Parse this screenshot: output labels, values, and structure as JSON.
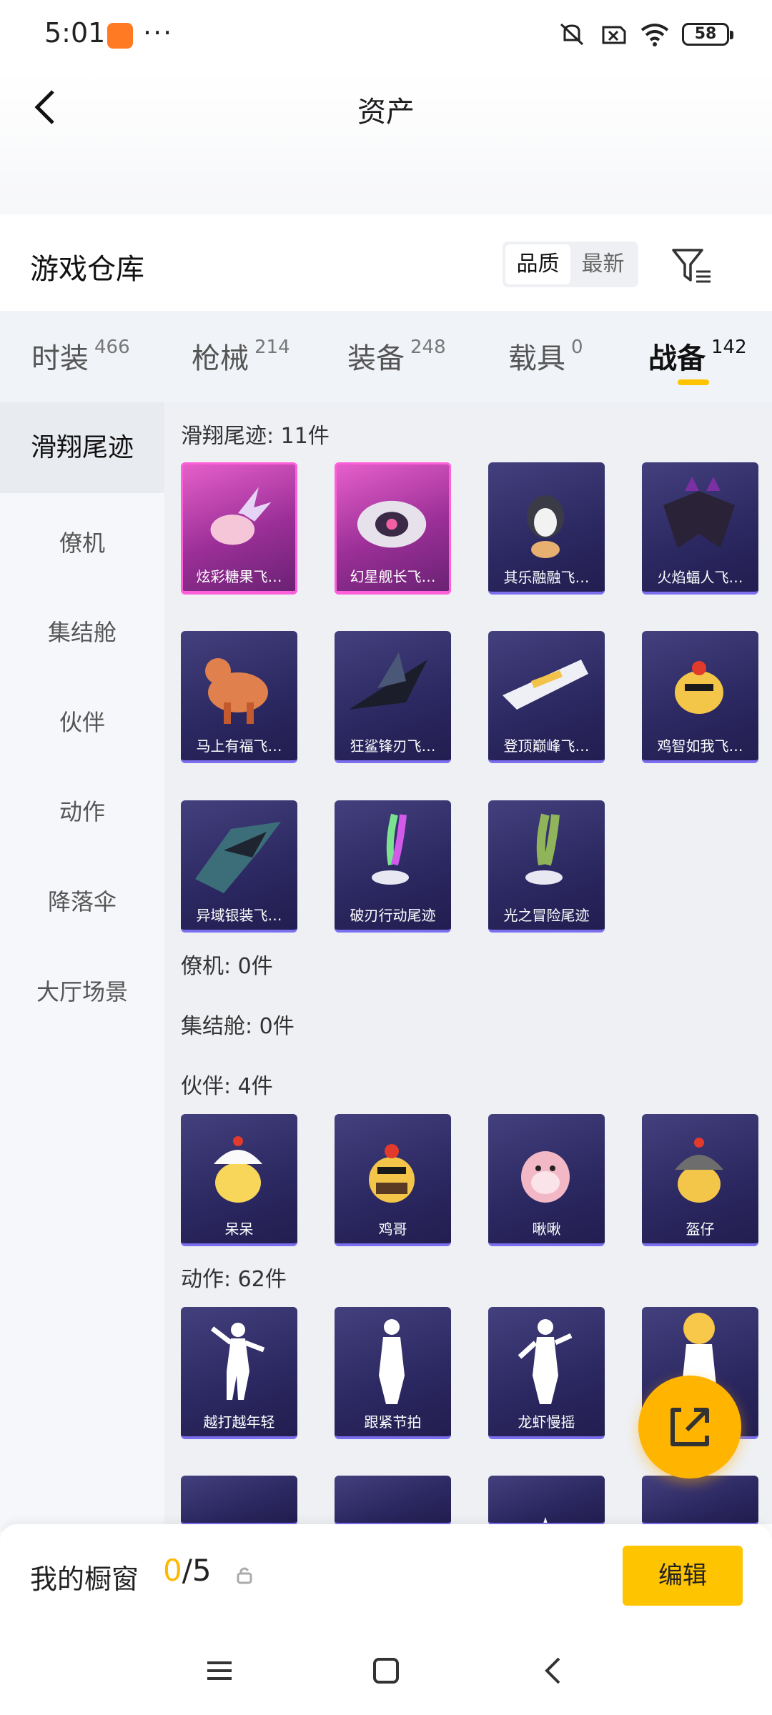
{
  "status_bar": {
    "time": "5:01",
    "dots": "···",
    "battery": "58"
  },
  "header": {
    "title": "资产"
  },
  "warehouse": {
    "title": "游戏仓库",
    "sort_options": [
      "品质",
      "最新"
    ]
  },
  "category_tabs": [
    {
      "label": "时装",
      "count": "466"
    },
    {
      "label": "枪械",
      "count": "214"
    },
    {
      "label": "装备",
      "count": "248"
    },
    {
      "label": "载具",
      "count": "0"
    },
    {
      "label": "战备",
      "count": "142"
    }
  ],
  "sidebar": [
    "滑翔尾迹",
    "僚机",
    "集结舱",
    "伙伴",
    "动作",
    "降落伞",
    "大厅场景"
  ],
  "sections": {
    "glide": {
      "title": "滑翔尾迹: 11件",
      "items": [
        "炫彩糖果飞…",
        "幻星舰长飞…",
        "其乐融融飞…",
        "火焰蝠人飞…",
        "马上有福飞…",
        "狂鲨锋刃飞…",
        "登顶巅峰飞…",
        "鸡智如我飞…",
        "异域银装飞…",
        "破刃行动尾迹",
        "光之冒险尾迹"
      ]
    },
    "wingman": {
      "title": "僚机: 0件"
    },
    "pod": {
      "title": "集结舱: 0件"
    },
    "partner": {
      "title": "伙伴: 4件",
      "items": [
        "呆呆",
        "鸡哥",
        "啾啾",
        "盔仔"
      ]
    },
    "emote": {
      "title": "动作: 62件",
      "items": [
        "越打越年轻",
        "跟紧节拍",
        "龙虾慢摇"
      ]
    }
  },
  "showcase": {
    "label": "我的橱窗",
    "current": "0",
    "total": "/5",
    "edit": "编辑"
  },
  "colors": {
    "accent": "#ffc400",
    "card_purple": "#2b2760",
    "card_pink": "#c042b5"
  }
}
